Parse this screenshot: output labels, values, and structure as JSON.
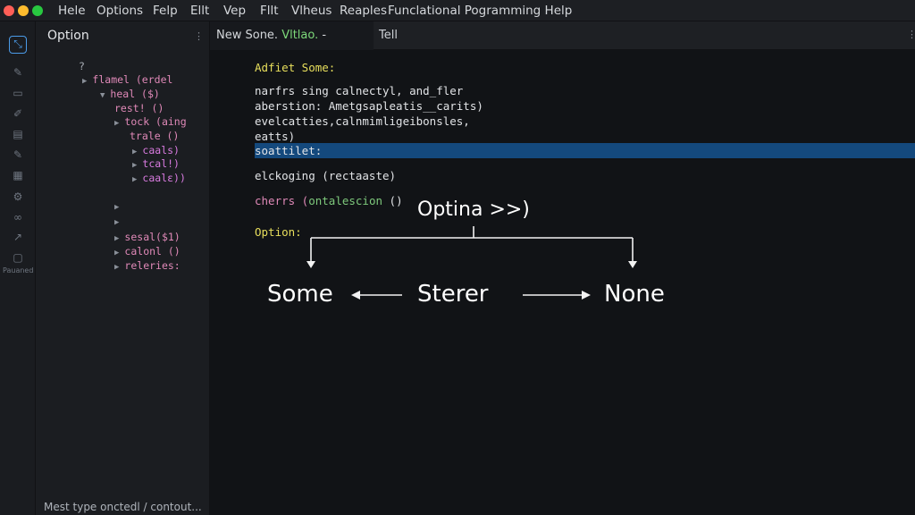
{
  "window": {
    "controls": {
      "close_color": "#ff5f57",
      "minimize_color": "#febc2e",
      "maximize_color": "#28c840"
    }
  },
  "menubar": {
    "items": [
      "Hele",
      "Options",
      "Felp",
      "Ellt",
      "Vep",
      "Fllt",
      "Vlheus",
      "Reaples",
      "Funclational Pogramming Help"
    ]
  },
  "activity_bar": {
    "icons": [
      "explorer-icon",
      "brush-icon",
      "chat-icon",
      "pencil-icon",
      "panel-icon",
      "edit-icon",
      "grid-icon",
      "debug-icon",
      "extensions-icon",
      "wand-icon",
      "settings-icon"
    ],
    "label": "Pauaned"
  },
  "sidebar": {
    "title": "Option",
    "more": "⋮",
    "tree": [
      {
        "label": "?",
        "twisty": "",
        "style": "plain"
      },
      {
        "label": "flamel (erdel",
        "twisty": "▶",
        "style": "pink"
      },
      {
        "label": "heal ($)",
        "twisty": "▼",
        "style": "pink"
      },
      {
        "label": "rest! ()",
        "twisty": "",
        "style": "pink"
      },
      {
        "label": "tock (aing",
        "twisty": "▶",
        "style": "pink"
      },
      {
        "label": "trale ()",
        "twisty": "",
        "style": "pink"
      },
      {
        "label": "caals)",
        "twisty": "▶",
        "style": "magenta"
      },
      {
        "label": "tcal!)",
        "twisty": "▶",
        "style": "magenta"
      },
      {
        "label": "caalε))",
        "twisty": "▶",
        "style": "magenta"
      },
      {
        "label": "",
        "twisty": "▶",
        "style": "plain"
      },
      {
        "label": "",
        "twisty": "▶",
        "style": "plain"
      },
      {
        "label": "sesal($1)",
        "twisty": "▶",
        "style": "pink"
      },
      {
        "label": "calonl ()",
        "twisty": "▶",
        "style": "pink"
      },
      {
        "label": "releries:",
        "twisty": "▶",
        "style": "pink"
      }
    ],
    "status": "Mest type onctedl / contout..."
  },
  "tabs": {
    "active_prefix": "New Sone.",
    "active_accent": "Vltlao.",
    "active_suffix": " -",
    "second": "Tell",
    "more": "⋮"
  },
  "editor": {
    "lines": [
      {
        "text": "Adfiet Some:",
        "style": "yellow"
      },
      {
        "text": "narfrs sing calnectyl, and_fler",
        "style": "white"
      },
      {
        "text": "aberstion: Ametgsapleatis__carits)",
        "style": "white"
      },
      {
        "text": "evelcatties,calnmimligeibonsles,",
        "style": "white"
      },
      {
        "text": "eatts)",
        "style": "white"
      },
      {
        "text": "soattilet:",
        "style": "white"
      },
      {
        "text": "elckoging (rectaaste)",
        "style": "white"
      },
      {
        "text": "cherrs (",
        "style": "pink"
      },
      {
        "text": "Option:",
        "style": "yellow"
      }
    ],
    "cherrs_arg": "ontalescion",
    "cherrs_end": " ()"
  },
  "diagram": {
    "top_label": "Optina >>)",
    "left_label": "Some",
    "center_label": "Sterer",
    "right_label": "None"
  }
}
